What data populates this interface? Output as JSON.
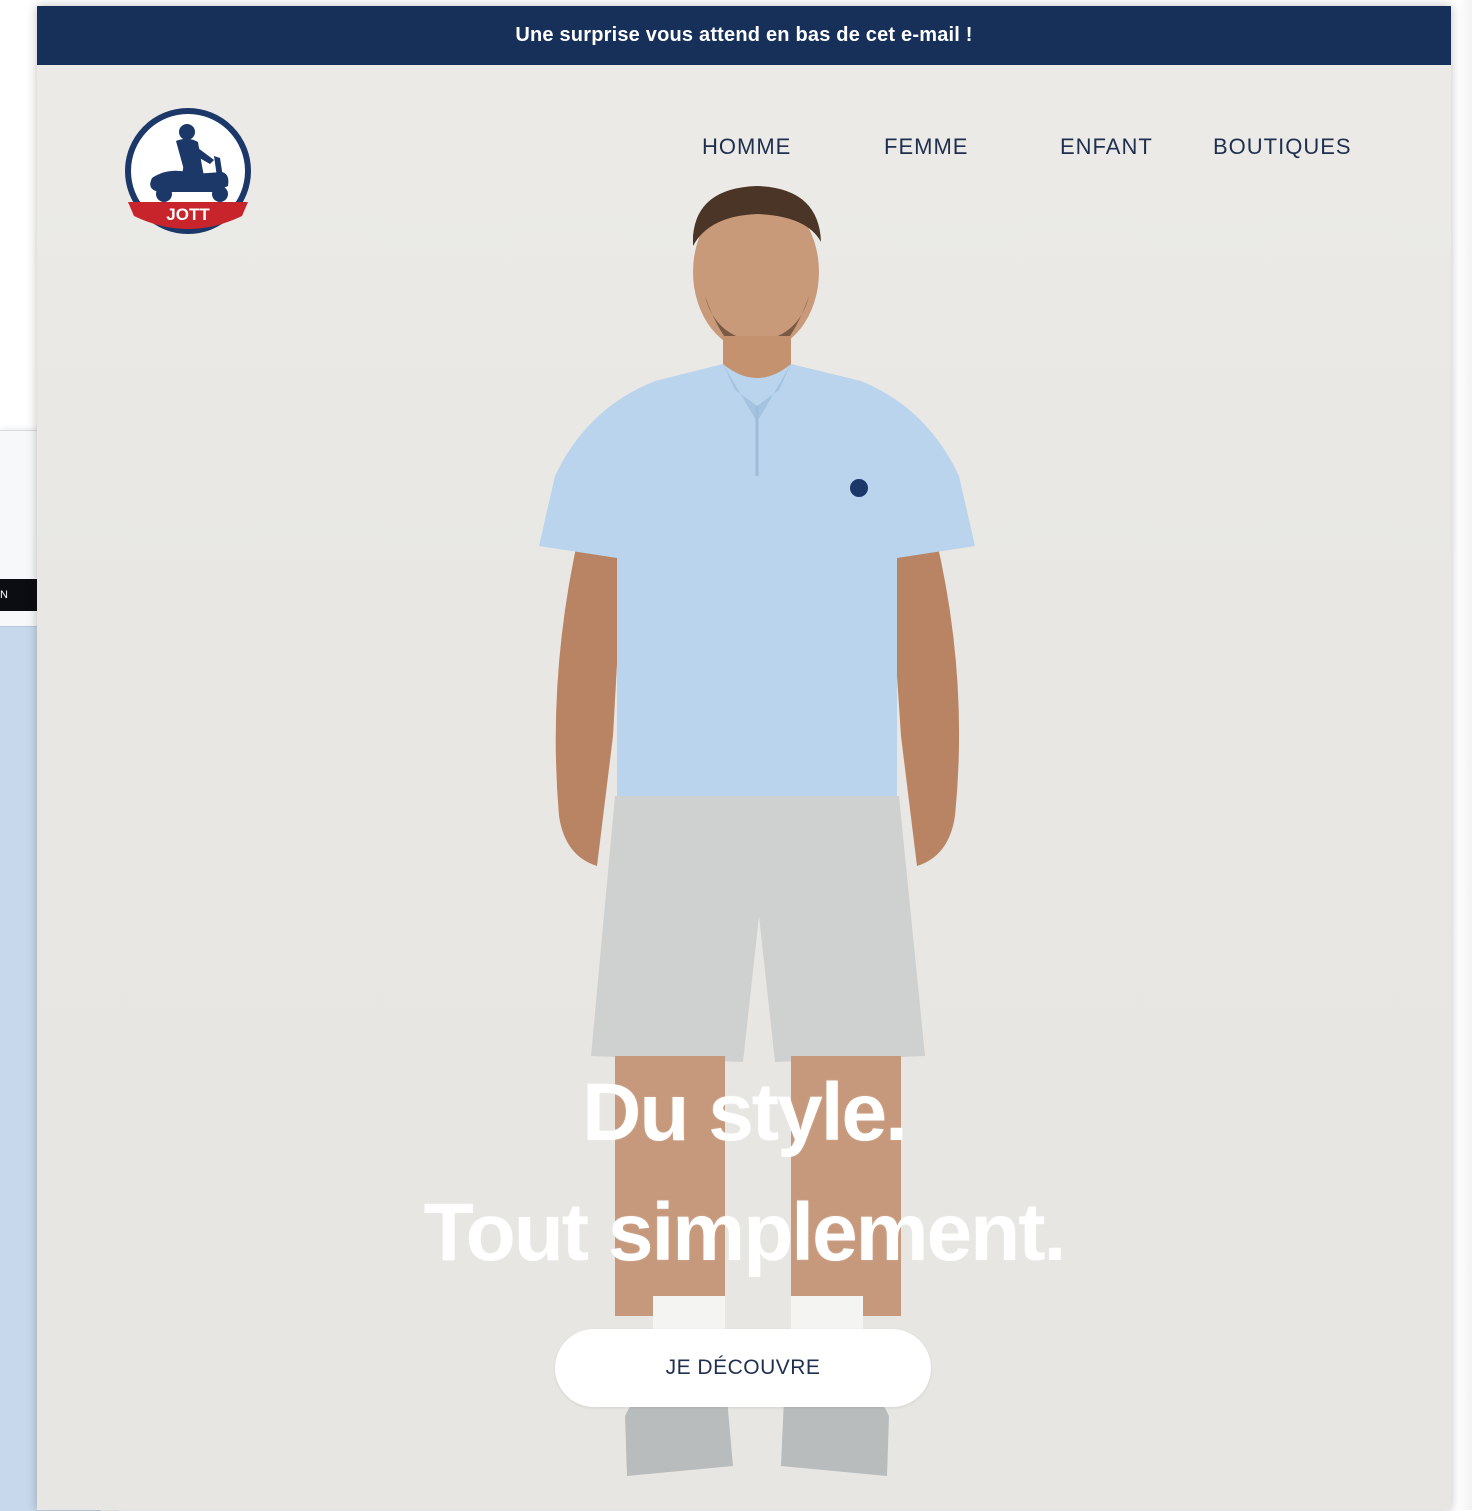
{
  "background_window": {
    "dark_bar_text": "N"
  },
  "email": {
    "banner": "Une surprise vous attend en bas de cet e-mail !",
    "logo": {
      "icon": "scooter-rider-icon",
      "text": "JOTT"
    },
    "nav": [
      {
        "label": "HOMME"
      },
      {
        "label": "FEMME"
      },
      {
        "label": "ENFANT"
      },
      {
        "label": "BOUTIQUES"
      }
    ],
    "hero": {
      "headline_line1": "Du style.",
      "headline_line2": "Tout simplement.",
      "cta_label": "JE DÉCOUVRE"
    }
  },
  "colors": {
    "banner_bg": "#17305a",
    "nav_text": "#1f2f4f",
    "logo_red": "#c8242c",
    "logo_navy": "#1b3868",
    "polo": "#b9d4ec",
    "shorts": "#cfd1d1"
  }
}
